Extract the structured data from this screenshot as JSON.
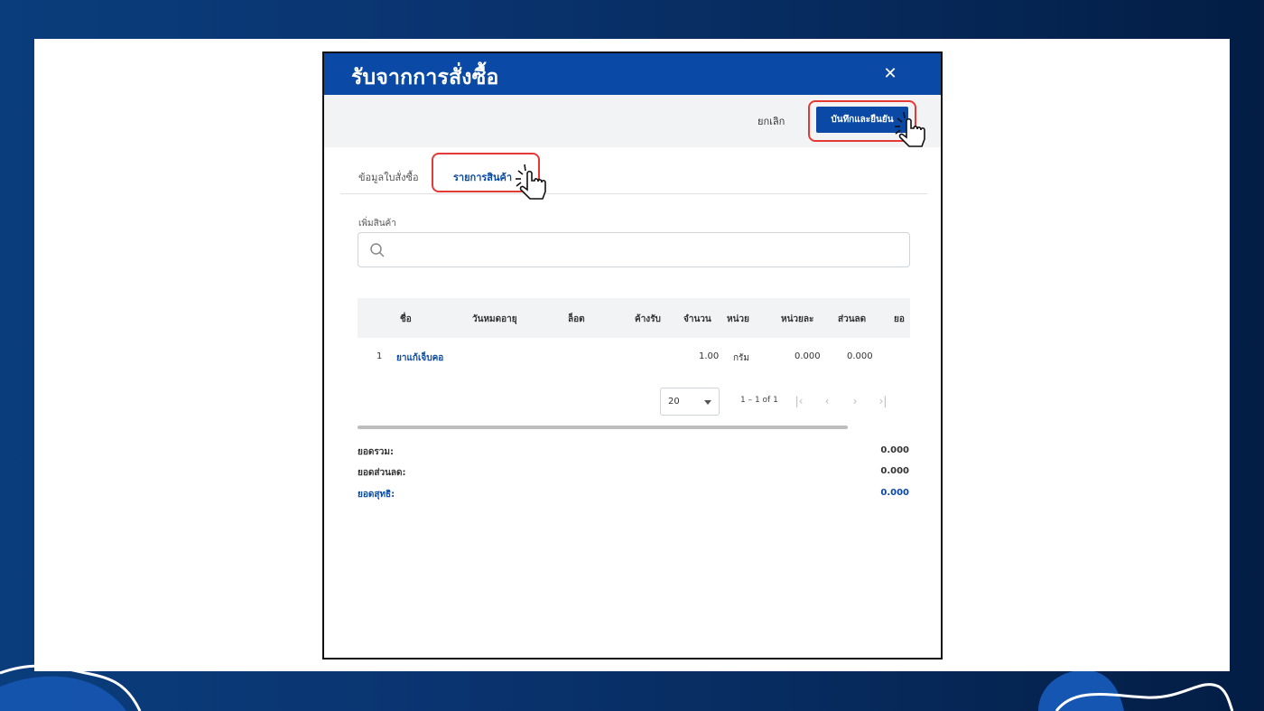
{
  "dialog": {
    "title": "รับจากการสั่งซื้อ",
    "close_icon": "close-icon"
  },
  "toolbar": {
    "cancel_label": "ยกเลิก",
    "save_label": "บันทึกและยืนยัน"
  },
  "tabs": [
    {
      "label": "ข้อมูลใบสั่งซื้อ",
      "active": false
    },
    {
      "label": "รายการสินค้า",
      "active": true
    }
  ],
  "add_product": {
    "label": "เพิ่มสินค้า",
    "placeholder": "",
    "value": ""
  },
  "table": {
    "columns": [
      "ชื่อ",
      "วันหมดอายุ",
      "ล็อต",
      "ค้างรับ",
      "จำนวน",
      "หน่วย",
      "หน่วยละ",
      "ส่วนลด",
      "ยอ"
    ],
    "rows": [
      {
        "index": "1",
        "name": "ยาแก้เจ็บคอ",
        "expiry": "",
        "lot": "",
        "pending": "",
        "qty": "1.00",
        "unit": "กรัม",
        "unit_price": "0.000",
        "discount": "0.000"
      }
    ]
  },
  "pagination": {
    "page_size": "20",
    "range": "1 – 1 of 1"
  },
  "summary": {
    "total_label": "ยอดรวม:",
    "total_value": "0.000",
    "discount_label": "ยอดส่วนลด:",
    "discount_value": "0.000",
    "net_label": "ยอดสุทธิ:",
    "net_value": "0.000"
  },
  "colors": {
    "primary": "#0a4aa6",
    "highlight": "#e53935",
    "background": "#0a3470"
  }
}
